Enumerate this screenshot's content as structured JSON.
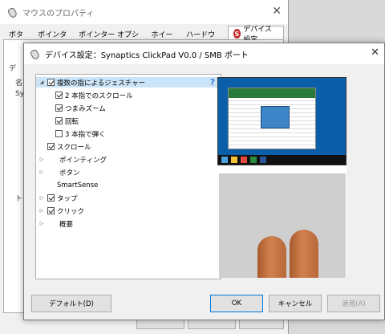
{
  "background_window": {
    "title": "マウスのプロパティ",
    "tabs": [
      "ボタン",
      "ポインター",
      "ポインター オプション",
      "ホイール",
      "ハードウェア",
      "デバイス設定"
    ],
    "panel_fragments": [
      "デ",
      "名",
      "Syn",
      "ト"
    ]
  },
  "dialog": {
    "title": "デバイス設定：Synaptics ClickPad V0.0 / SMB ポート",
    "help_icon": "?",
    "tree": [
      {
        "label": "複数の指によるジェスチャー",
        "checked": true,
        "expandable": true,
        "expanded": true,
        "selected": true,
        "level": 0
      },
      {
        "label": "2 本指でのスクロール",
        "checked": true,
        "level": 1
      },
      {
        "label": "つまみズーム",
        "checked": true,
        "level": 1
      },
      {
        "label": "回転",
        "checked": true,
        "level": 1
      },
      {
        "label": "3 本指で弾く",
        "checked": false,
        "level": 1
      },
      {
        "label": "スクロール",
        "checked": true,
        "level": 0
      },
      {
        "label": "ポインティング",
        "expandable": true,
        "level": 0
      },
      {
        "label": "ボタン",
        "expandable": true,
        "level": 0
      },
      {
        "label": "SmartSense",
        "level": 0
      },
      {
        "label": "タップ",
        "checked": true,
        "expandable": true,
        "level": 0
      },
      {
        "label": "クリック",
        "checked": true,
        "expandable": true,
        "level": 0
      },
      {
        "label": "概要",
        "expandable": true,
        "level": 0
      }
    ],
    "buttons": {
      "default": "デフォルト(D)",
      "ok": "OK",
      "cancel": "キャンセル",
      "apply": "適用(A)"
    }
  },
  "colors": {
    "selection": "#cce4f7",
    "desktop_blue": "#0b5fa8",
    "brand_red": "#c8282d"
  }
}
